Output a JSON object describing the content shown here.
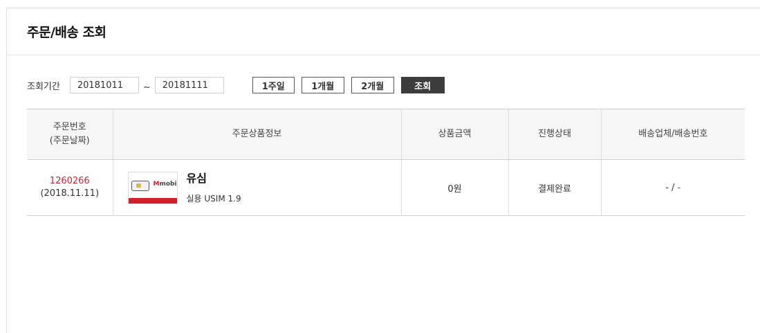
{
  "page": {
    "title": "주문/배송 조회"
  },
  "search": {
    "period_label": "조회기간",
    "start_date": "20181011",
    "separator": "~",
    "end_date": "20181111",
    "buttons": {
      "one_week": "1주일",
      "one_month": "1개월",
      "two_months": "2개월",
      "search": "조회"
    }
  },
  "table": {
    "headers": {
      "order_no": "주문번호",
      "order_date": "(주문날짜)",
      "product_info": "주문상품정보",
      "price": "상품금액",
      "status": "진행상태",
      "shipping": "배송업체/배송번호"
    },
    "rows": [
      {
        "order_no": "1260266",
        "order_date": "(2018.11.11)",
        "product_name": "유심",
        "product_desc": "실용 USIM 1.9",
        "price": "0원",
        "status": "결제완료",
        "carrier": "-",
        "tracking_separator": " / ",
        "tracking_no": "-"
      }
    ]
  },
  "colors": {
    "accent": "#d11f2e",
    "button_dark": "#3d3d3d",
    "header_bg": "#f6f6f6"
  }
}
